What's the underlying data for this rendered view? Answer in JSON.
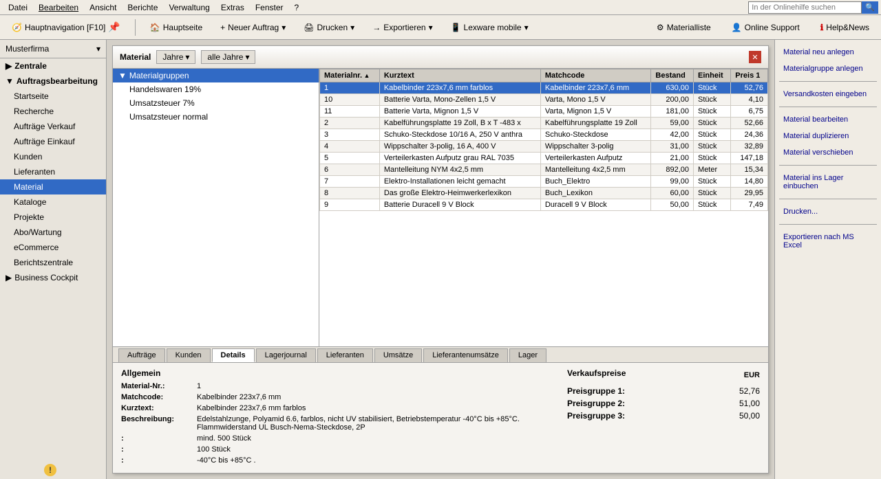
{
  "menuBar": {
    "items": [
      "Datei",
      "Bearbeiten",
      "Ansicht",
      "Berichte",
      "Verwaltung",
      "Extras",
      "Fenster",
      "?"
    ],
    "searchPlaceholder": "In der Onlinehilfe suchen"
  },
  "toolbar": {
    "navLabel": "Hauptnavigation [F10]",
    "buttons": [
      {
        "id": "home",
        "label": "Hauptseite",
        "icon": "🏠"
      },
      {
        "id": "new",
        "label": "Neuer Auftrag",
        "icon": "+"
      },
      {
        "id": "print",
        "label": "Drucken",
        "icon": "🖨"
      },
      {
        "id": "export",
        "label": "Exportieren",
        "icon": "→"
      },
      {
        "id": "mobile",
        "label": "Lexware mobile",
        "icon": "📱"
      }
    ],
    "rightItems": [
      {
        "id": "materialliste",
        "label": "Materialliste",
        "icon": "⚙"
      },
      {
        "id": "support",
        "label": "Online Support",
        "icon": "👤"
      },
      {
        "id": "help",
        "label": "Help&News",
        "icon": "❓"
      }
    ]
  },
  "sidebar": {
    "company": "Musterfirma",
    "groups": [
      {
        "id": "zentrale",
        "label": "Zentrale",
        "expanded": false
      },
      {
        "id": "auftragsbearbeitung",
        "label": "Auftragsbearbeitung",
        "expanded": true,
        "items": [
          "Startseite",
          "Recherche",
          "Aufträge Verkauf",
          "Aufträge Einkauf",
          "Kunden",
          "Lieferanten",
          "Material",
          "Kataloge",
          "Projekte",
          "Abo/Wartung",
          "eCommerce",
          "Berichtszentrale"
        ]
      },
      {
        "id": "cockpit",
        "label": "Business Cockpit",
        "expanded": false
      }
    ]
  },
  "materialWindow": {
    "title": "Material",
    "filterLabel1": "Jahre",
    "filterArrow1": "▾",
    "filterLabel2": "alle Jahre",
    "filterArrow2": "▾",
    "treeItems": [
      {
        "label": "Materialgruppen",
        "level": 0,
        "selected": true,
        "icon": "▼"
      },
      {
        "label": "Handelswaren 19%",
        "level": 1,
        "selected": false
      },
      {
        "label": "Umsatzsteuer 7%",
        "level": 1,
        "selected": false
      },
      {
        "label": "Umsatzsteuer normal",
        "level": 1,
        "selected": false
      }
    ],
    "tableHeaders": [
      "Materialnr.",
      "Kurztext",
      "Matchcode",
      "Bestand",
      "Einheit",
      "Preis 1"
    ],
    "tableRows": [
      {
        "id": 1,
        "nr": "1",
        "kurztext": "Kabelbinder 223x7,6 mm farblos",
        "matchcode": "Kabelbinder 223x7,6 mm",
        "bestand": "630,00",
        "einheit": "Stück",
        "preis": "52,76",
        "selected": true
      },
      {
        "id": 2,
        "nr": "10",
        "kurztext": "Batterie Varta, Mono-Zellen 1,5 V",
        "matchcode": "Varta, Mono 1,5 V",
        "bestand": "200,00",
        "einheit": "Stück",
        "preis": "4,10",
        "selected": false
      },
      {
        "id": 3,
        "nr": "11",
        "kurztext": "Batterie Varta, Mignon 1,5 V",
        "matchcode": "Varta, Mignon 1,5 V",
        "bestand": "181,00",
        "einheit": "Stück",
        "preis": "6,75",
        "selected": false
      },
      {
        "id": 4,
        "nr": "2",
        "kurztext": "Kabelführungsplatte 19 Zoll,  B x T -483 x",
        "matchcode": "Kabelführungsplatte 19 Zoll",
        "bestand": "59,00",
        "einheit": "Stück",
        "preis": "52,66",
        "selected": false
      },
      {
        "id": 5,
        "nr": "3",
        "kurztext": "Schuko-Steckdose 10/16 A, 250 V anthra",
        "matchcode": "Schuko-Steckdose",
        "bestand": "42,00",
        "einheit": "Stück",
        "preis": "24,36",
        "selected": false
      },
      {
        "id": 6,
        "nr": "4",
        "kurztext": "Wippschalter 3-polig, 16 A, 400 V",
        "matchcode": "Wippschalter 3-polig",
        "bestand": "31,00",
        "einheit": "Stück",
        "preis": "32,89",
        "selected": false
      },
      {
        "id": 7,
        "nr": "5",
        "kurztext": "Verteilerkasten Aufputz grau RAL 7035",
        "matchcode": "Verteilerkasten Aufputz",
        "bestand": "21,00",
        "einheit": "Stück",
        "preis": "147,18",
        "selected": false
      },
      {
        "id": 8,
        "nr": "6",
        "kurztext": "Mantelleitung NYM 4x2,5 mm",
        "matchcode": "Mantelleitung 4x2,5 mm",
        "bestand": "892,00",
        "einheit": "Meter",
        "preis": "15,34",
        "selected": false
      },
      {
        "id": 9,
        "nr": "7",
        "kurztext": "Elektro-Installationen leicht gemacht",
        "matchcode": "Buch_Elektro",
        "bestand": "99,00",
        "einheit": "Stück",
        "preis": "14,80",
        "selected": false
      },
      {
        "id": 10,
        "nr": "8",
        "kurztext": "Das große Elektro-Heimwerkerlexikon",
        "matchcode": "Buch_Lexikon",
        "bestand": "60,00",
        "einheit": "Stück",
        "preis": "29,95",
        "selected": false
      },
      {
        "id": 11,
        "nr": "9",
        "kurztext": "Batterie Duracell 9 V Block",
        "matchcode": "Duracell 9 V Block",
        "bestand": "50,00",
        "einheit": "Stück",
        "preis": "7,49",
        "selected": false
      }
    ]
  },
  "bottomTabs": {
    "tabs": [
      "Aufträge",
      "Kunden",
      "Details",
      "Lagerjournal",
      "Lieferanten",
      "Umsätze",
      "Lieferantenumsätze",
      "Lager"
    ],
    "activeTab": "Details"
  },
  "detailSection": {
    "title": "Allgemein",
    "fields": [
      {
        "label": "Material-Nr.:",
        "value": "1"
      },
      {
        "label": "Matchcode:",
        "value": "Kabelbinder 223x7,6 mm"
      },
      {
        "label": "Kurztext:",
        "value": "Kabelbinder 223x7,6 mm farblos"
      },
      {
        "label": "Beschreibung:",
        "value": "Edelstahlzunge, Polyamid 6.6, farblos, nicht UV stabilisiert, Betriebstemperatur -40°C bis +85°C. Flammwiderstand UL Busch-Nema-Steckdose, 2P"
      },
      {
        "label": ":",
        "value": "mind. 500 Stück"
      },
      {
        "label": ":",
        "value": "100 Stück"
      },
      {
        "label": ":",
        "value": "-40°C bis +85°C ."
      }
    ]
  },
  "priceSection": {
    "currency": "EUR",
    "title": "Verkaufspreise",
    "prices": [
      {
        "label": "Preisgruppe 1:",
        "value": "52,76"
      },
      {
        "label": "Preisgruppe 2:",
        "value": "51,00"
      },
      {
        "label": "Preisgruppe 3:",
        "value": "50,00"
      }
    ]
  },
  "rightPanel": {
    "actions": [
      "Material neu anlegen",
      "Materialgruppe anlegen",
      "Versandkosten eingeben",
      "Material bearbeiten",
      "Material duplizieren",
      "Material verschieben",
      "Material ins Lager einbuchen",
      "Drucken...",
      "Exportieren nach MS Excel"
    ]
  }
}
